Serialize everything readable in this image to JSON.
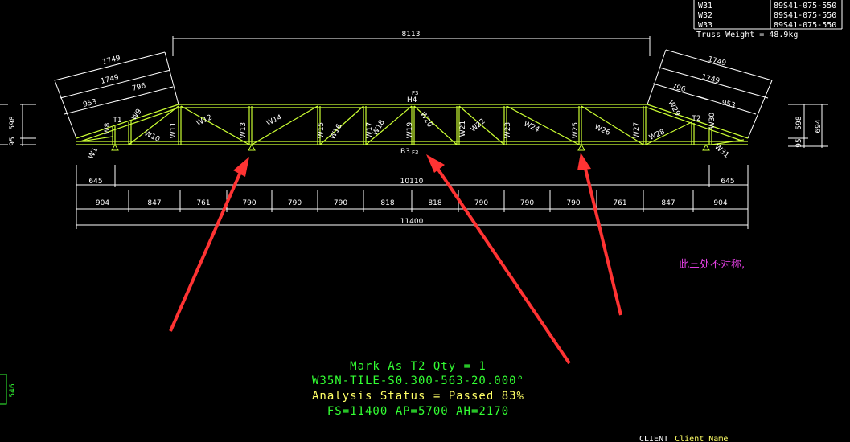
{
  "colors": {
    "background": "#000000",
    "truss": "#ccff33",
    "dimension": "#ffffff",
    "arrow": "#ff3333",
    "note": "#e040e0",
    "status_green": "#33ff33",
    "status_yellow": "#ffff66"
  },
  "weights_table": {
    "rows": [
      {
        "member": "W31",
        "spec": "89S41-075-550"
      },
      {
        "member": "W32",
        "spec": "89S41-075-550"
      },
      {
        "member": "W33",
        "spec": "89S41-075-550"
      }
    ],
    "truss_weight": "Truss Weight = 48.9kg"
  },
  "dimensions": {
    "top_overall": "8113",
    "left_slope": [
      "1749",
      "1749",
      "953",
      "796"
    ],
    "right_slope": [
      "1749",
      "1749",
      "796",
      "953"
    ],
    "left_height": [
      "598",
      "95"
    ],
    "right_height": [
      "598",
      "694",
      "95"
    ],
    "mid_row": [
      "645",
      "10110",
      "645"
    ],
    "panels": [
      "904",
      "847",
      "761",
      "790",
      "790",
      "790",
      "818",
      "818",
      "790",
      "790",
      "790",
      "761",
      "847",
      "904"
    ],
    "overall": "11400",
    "lower_left_small": "546"
  },
  "members": {
    "webs": [
      "W1",
      "W8",
      "T1",
      "W9",
      "W10",
      "W11",
      "W12",
      "W13",
      "W14",
      "W15",
      "W16",
      "W17",
      "W18",
      "W19",
      "W20",
      "W21",
      "W22",
      "W23",
      "W24",
      "W25",
      "W26",
      "W27",
      "W28",
      "W29",
      "T2",
      "W30",
      "W31"
    ],
    "nodes": {
      "top_center": "H4",
      "bottom_center": "B3",
      "plate_top": "F3",
      "plate_bottom": "F3"
    }
  },
  "annotation": {
    "note": "此三处不对称,"
  },
  "status": {
    "mark": "Mark As T2 Qty = 1",
    "profile": "W35N-TILE-S0.300-563-20.000°",
    "analysis": "Analysis Status = Passed 83%",
    "params": "FS=11400 AP=5700 AH=2170"
  },
  "footer": {
    "client_label": "CLIENT",
    "client_value": "Client Name"
  }
}
